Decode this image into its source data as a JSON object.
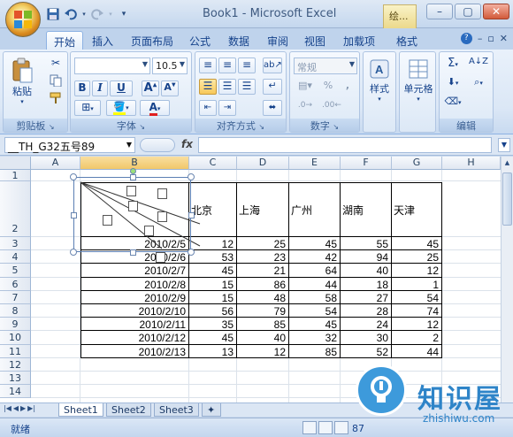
{
  "window": {
    "title": "Book1 - Microsoft Excel",
    "context_tab": "绘...",
    "controls": [
      "minimize",
      "maximize",
      "close"
    ]
  },
  "quick_access": {
    "icons": [
      "save-icon",
      "undo-icon",
      "redo-icon",
      "customize-icon"
    ]
  },
  "tabs": [
    "开始",
    "插入",
    "页面布局",
    "公式",
    "数据",
    "审阅",
    "视图",
    "加载项",
    "格式"
  ],
  "active_tab": "开始",
  "ribbon": {
    "clipboard": {
      "group_label": "剪贴板",
      "paste_label": "粘贴"
    },
    "font": {
      "group_label": "字体",
      "font_name": "",
      "font_size": "10.5",
      "bold": "B",
      "italic": "I",
      "underline": "U"
    },
    "alignment": {
      "group_label": "对齐方式"
    },
    "number": {
      "group_label": "数字",
      "format": "常规",
      "percent": "%",
      "comma": ","
    },
    "styles": {
      "label": "样式"
    },
    "cells": {
      "label": "单元格"
    },
    "editing": {
      "group_label": "编辑"
    }
  },
  "formula_bar": {
    "name_box": "__TH_G32五号89",
    "fx": "fx",
    "formula": ""
  },
  "columns": [
    "A",
    "B",
    "C",
    "D",
    "E",
    "F",
    "G",
    "H"
  ],
  "rows": [
    "1",
    "2",
    "3",
    "4",
    "5",
    "6",
    "7",
    "8",
    "9",
    "10",
    "11",
    "12",
    "13",
    "14"
  ],
  "table": {
    "headers": [
      "北京",
      "上海",
      "广州",
      "湖南",
      "天津"
    ],
    "rows": [
      {
        "date": "2010/2/5",
        "values": [
          "12",
          "25",
          "45",
          "55",
          "45"
        ]
      },
      {
        "date": "2010/2/6",
        "values": [
          "53",
          "23",
          "42",
          "94",
          "25"
        ]
      },
      {
        "date": "2010/2/7",
        "values": [
          "45",
          "21",
          "64",
          "40",
          "12"
        ]
      },
      {
        "date": "2010/2/8",
        "values": [
          "15",
          "86",
          "44",
          "18",
          "1"
        ]
      },
      {
        "date": "2010/2/9",
        "values": [
          "15",
          "48",
          "58",
          "27",
          "54"
        ]
      },
      {
        "date": "2010/2/10",
        "values": [
          "56",
          "79",
          "54",
          "28",
          "74"
        ]
      },
      {
        "date": "2010/2/11",
        "values": [
          "35",
          "85",
          "45",
          "24",
          "12"
        ]
      },
      {
        "date": "2010/2/12",
        "values": [
          "45",
          "40",
          "32",
          "30",
          "2"
        ]
      },
      {
        "date": "2010/2/13",
        "values": [
          "13",
          "12",
          "85",
          "52",
          "44"
        ]
      }
    ]
  },
  "sheet_tabs": [
    "Sheet1",
    "Sheet2",
    "Sheet3"
  ],
  "active_sheet": "Sheet1",
  "status": {
    "ready": "就绪",
    "zoom": "87"
  },
  "watermark": {
    "name": "知识屋",
    "url": "zhishiwu.com"
  }
}
